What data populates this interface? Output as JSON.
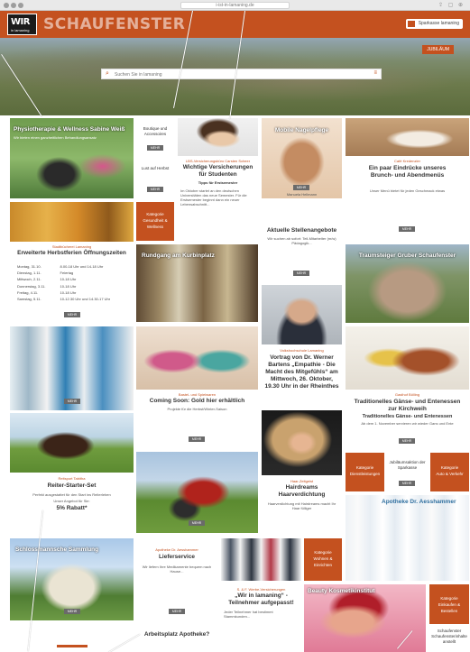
{
  "browser": {
    "url": "i-ist-in-lamaning.de"
  },
  "header": {
    "logo": "WIR",
    "logo_sub": "in lamaning",
    "title": "SCHAUFENSTER",
    "sponsor": "Sparkasse lamaning"
  },
  "hero": {
    "badge": "JUBILÄUM",
    "search_placeholder": "Suchen Sie in lamaning"
  },
  "tiles": {
    "physio": {
      "title": "Physiotherapie & Wellness Sabine Weiß",
      "sub": "Wir bieten einen ganzheitlichen Behandlungsansatz"
    },
    "boutique": {
      "label1": "Boutique und",
      "label2": "Accessoires",
      "label3": "Lust auf Herbst"
    },
    "versicherung": {
      "cat": "LBS-Versicherungsbüro Carsten Scheer",
      "title": "Wichtige Versicherungen für Studenten",
      "sub": "Tipps für Erstsemester",
      "body": "Im Oktober startet an den deutschen Universitäten das neue Semester. Für die Erstsemester beginnt dann ein neuer Lebensabschnitt..."
    },
    "nagel": {
      "title": "Mobile Nagelpflege",
      "sub": "Manuela Hellmann"
    },
    "eindruecke": {
      "cat": "Café Kredenzler",
      "title": "Ein paar Eindrücke unseres Brunch- und Abendmenüs",
      "body": "Unser Menü bietet für jeden Geschmack etwas"
    },
    "gesundheit": {
      "label1": "Kategorie",
      "label2": "Gesundheit &",
      "label3": "Wellness"
    },
    "herbst": {
      "cat": "Stadtbücherei Lamaning",
      "title": "Erweiterte Herbstferien Öffnungszeiten",
      "hours": [
        [
          "Montag, 31.10.",
          "8.00-18 Uhr  und 14-18 Uhr"
        ],
        [
          "Dienstag, 1.11.",
          "Feiertag"
        ],
        [
          "Mittwoch, 2.11.",
          "10-18 Uhr"
        ],
        [
          "Donnerstag, 3.11.",
          "10-18 Uhr"
        ],
        [
          "Freitag, 4.11.",
          "10-18 Uhr"
        ],
        [
          "Samstag, 5.11.",
          "10-12.30 Uhr  und  14.30-17 Uhr"
        ]
      ]
    },
    "rundgang": {
      "title": "Rundgang am Kurbinplatz"
    },
    "stellen": {
      "title": "Aktuelle Stellenangebote",
      "body": "Wir suchen ab sofort: Teil-Mitarbeiter (m/w) Pädagogik...",
      "sub": "Familien-Studentin Training und Weiterbildung"
    },
    "luftbild": {
      "title": "Traumsteiger Gruber Schaufenster"
    },
    "vortrag": {
      "cat": "Volkshochschule Lamaning",
      "title": "Vortrag von Dr. Werner Bartens „Empathie - Die Macht des Mitgefühls“ am Mittwoch, 26. Oktober, 19.30 Uhr in der Rheinthes"
    },
    "apotheke_shop": {},
    "hasen": {
      "cat": "Bastel- und Spielwaren",
      "title": "Coming Soon: Gold hier erhältlich",
      "body": "Projekte für die Herbst/Winter-Saison"
    },
    "gaense": {
      "cat": "Gasthof Bölling",
      "title": "Traditionelles Gänse- und Entenessen zur Kirchweih",
      "sub": "Traditionelles Gänse- und Entenessen",
      "body": "Ab dem 1. November servieren wir wieder Gans und Ente"
    },
    "reiter": {
      "cat": "Reitsport Tabitha",
      "title": "Reiter-Starter-Set",
      "body": "Perfekt ausgestattet für den Start ins Reiterleben",
      "sub1": "Unser Angebot für Sie:",
      "sub2": "5% Rabatt*"
    },
    "traktor": {},
    "haar": {
      "cat": "Haar-Zeitgeist",
      "title": "Hairdreams Haarverdichtung",
      "body": "Haarverdichtung mit Hairdreams macht Ihr Haar fülliger"
    },
    "dienstleist": {
      "label1": "Kategorie",
      "label2": "Dienstleistungen"
    },
    "sparks": {
      "label1": "Jubiläumsaktion der",
      "label2": "Sparkasse"
    },
    "auto": {
      "label1": "Kategorie",
      "label2": "Auto & Verkehr"
    },
    "apotheke": {
      "title": "Apotheke Dr. Aesshammer"
    },
    "schloss": {
      "title": "Schlossmannsche Sammlung"
    },
    "liefer": {
      "cat": "Apotheke Dr. Aesshammer",
      "title": "Lieferservice",
      "body": "Wir liefern Ihre Medikamente bequem nach Hause..."
    },
    "team": {},
    "wohnen": {
      "label1": "Kategorie",
      "label2": "Wohnen &",
      "label3": "Einrichten"
    },
    "teilnehmer": {
      "cat": "S. & F. Werbe-Versicherungen",
      "title": "„Wir in lamaning“ - Teilnehmer aufgepasst!",
      "body": "Jeder Teilnehmer hat bestimmt Stammkunden..."
    },
    "kosmetik": {
      "title": "Beauty Kosmetikinstitut"
    },
    "einkaufen": {
      "label1": "Kategorie",
      "label2": "Einkaufen &",
      "label3": "Bestellen"
    },
    "schaufenster_sub": {
      "label1": "Schaufenster",
      "label2": "Schaufensterinhalte",
      "label3": "anstellt"
    },
    "arbeitsplatz": {
      "title": "Arbeitsplatz Apotheke?"
    }
  },
  "more_label": "MEHR",
  "colors": {
    "brand": "#c4511f",
    "button": "#6a6a6a"
  }
}
